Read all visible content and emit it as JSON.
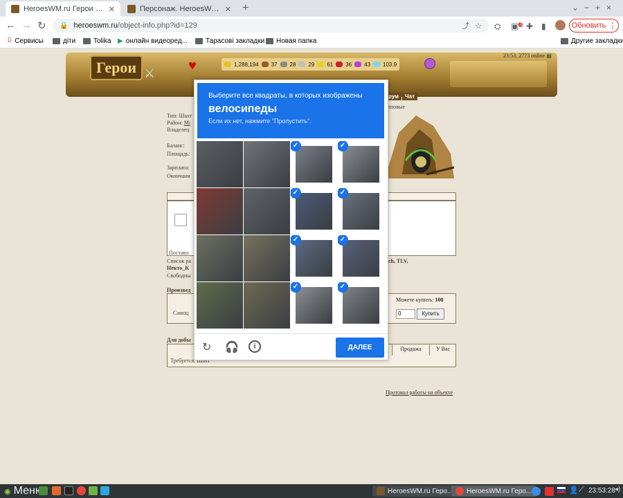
{
  "browser": {
    "tabs": [
      {
        "label": "HeroesWM.ru Герои войны и ",
        "active": true
      },
      {
        "label": "Персонаж. HeroesWM.ru Геро",
        "active": false
      }
    ],
    "new_tab_symbol": "+",
    "window_controls": [
      "⌄",
      "−",
      "+",
      "×"
    ],
    "url_domain": "heroeswm.ru",
    "url_path": "/object-info.php?id=129",
    "extension_badge": "3",
    "update_label": "Обновить",
    "bookmarks": [
      "Сервисы",
      "діти",
      "Tolika",
      "онлайн видеоред...",
      "Тарасові закладки",
      "Новая папка"
    ],
    "other_bookmarks": "Другие закладки"
  },
  "game": {
    "logo_text": "Герои",
    "server_time": "23:53, 2773 online",
    "resources": [
      {
        "icon": "gold-icon",
        "value": "1,288,194",
        "color": "#e8c020"
      },
      {
        "icon": "wood-icon",
        "value": "37",
        "color": "#9b5a22"
      },
      {
        "icon": "ore-icon",
        "value": "28",
        "color": "#8a8a8a"
      },
      {
        "icon": "mercury-icon",
        "value": "29",
        "color": "#bfbfbf"
      },
      {
        "icon": "sulfur-icon",
        "value": "61",
        "color": "#e6d21a"
      },
      {
        "icon": "crystal-icon",
        "value": "36",
        "color": "#d21a2a"
      },
      {
        "icon": "gems-icon",
        "value": "43",
        "color": "#c23bd1"
      },
      {
        "icon": "diamond-icon",
        "value": "103.9",
        "color": "#7ad6ff"
      }
    ],
    "nav": {
      "forum": "рум",
      "chat": "Чат"
    }
  },
  "object": {
    "type_label": "Тип: Шахт",
    "district_label": "Район: ",
    "district_value": "Mi",
    "owner_label": "Владелец",
    "balance_label": "Баланс:",
    "area_label": "Площадь:",
    "salary_label": "Зарплата:",
    "end_label": "Окончани",
    "top_right_text": "лповые",
    "supply_label": "Поставл",
    "list_label": "Список ра",
    "list_names": "ych, TLV,",
    "list_name2": "Некто_К",
    "free_label": "Свободны",
    "production_label": "Произвед",
    "self_label": "Самоц",
    "can_buy_label": "Можете купить:",
    "can_buy_value": "100",
    "buy_qty": "0",
    "buy_button": "Купить",
    "mining_label": "Для добы",
    "col_sale": "Продажа",
    "col_you": "У Вас",
    "required_label": "Требуется: Шахт",
    "protocol_link": "Протокол работы на объекте"
  },
  "captcha": {
    "instruction": "Выберите все квадраты, в которых изображены",
    "keyword": "велосипеды",
    "hint": "Если их нет, нажмите \"Пропустить\".",
    "verify_button": "ДАЛЕЕ",
    "check_symbol": "✓",
    "tiles": [
      {
        "selected": false,
        "color": "#5a5f63"
      },
      {
        "selected": false,
        "color": "#6f7479"
      },
      {
        "selected": true,
        "color": "#7c8088"
      },
      {
        "selected": true,
        "color": "#8a8f93"
      },
      {
        "selected": false,
        "color": "#803a35"
      },
      {
        "selected": false,
        "color": "#5f6468"
      },
      {
        "selected": true,
        "color": "#4a5a78"
      },
      {
        "selected": true,
        "color": "#6a727c"
      },
      {
        "selected": false,
        "color": "#6b6f61"
      },
      {
        "selected": false,
        "color": "#77725f"
      },
      {
        "selected": true,
        "color": "#5e6a84"
      },
      {
        "selected": true,
        "color": "#59617a"
      },
      {
        "selected": false,
        "color": "#5f6b4c"
      },
      {
        "selected": false,
        "color": "#6d6a54"
      },
      {
        "selected": true,
        "color": "#8d8f94"
      },
      {
        "selected": true,
        "color": "#7e8388"
      }
    ]
  },
  "taskbar": {
    "menu_label": "Меню",
    "windows": [
      "HeroesWM.ru Геро...",
      "HeroesWM.ru Геро..."
    ],
    "clock": "23:53:28"
  }
}
